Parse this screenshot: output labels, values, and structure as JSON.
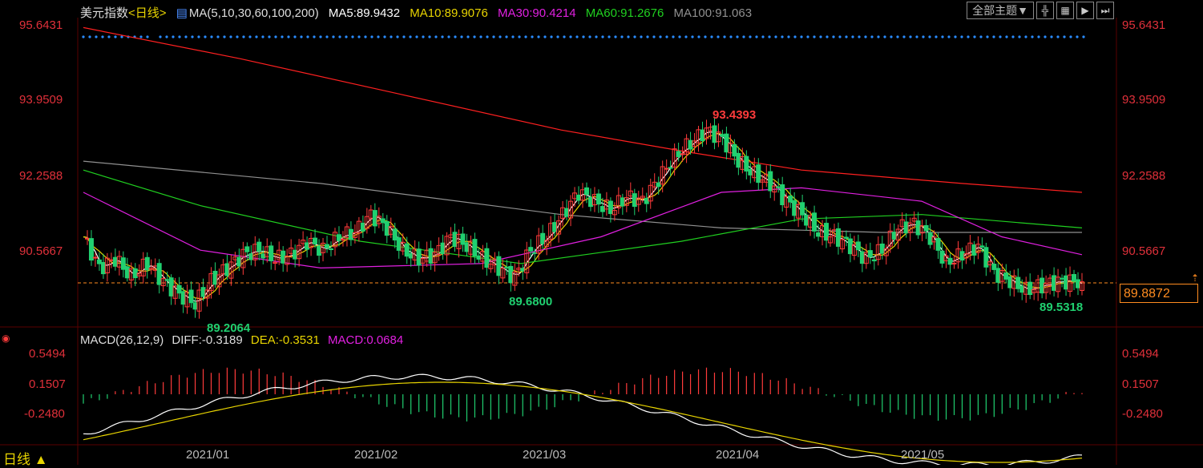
{
  "header": {
    "title": "美元指数",
    "period": "<日线>",
    "ma_label": "MA(5,10,30,60,100,200)",
    "ma5": "MA5:89.9432",
    "ma10": "MA10:89.9076",
    "ma30": "MA30:90.4214",
    "ma60": "MA60:91.2676",
    "ma100": "MA100:91.063"
  },
  "toolbar": {
    "theme_select": "全部主题▼"
  },
  "macd_header": {
    "label": "MACD(26,12,9)",
    "diff": "DIFF:-0.3189",
    "dea": "DEA:-0.3531",
    "macd": "MACD:0.0684"
  },
  "price_axis": [
    "95.6431",
    "93.9509",
    "92.2588",
    "90.5667"
  ],
  "macd_axis": [
    "0.5494",
    "0.1507",
    "-0.2480"
  ],
  "x_axis": [
    "2021/01",
    "2021/02",
    "2021/03",
    "2021/04",
    "2021/05"
  ],
  "last_price": "89.8872",
  "annotations": {
    "high": "93.4393",
    "low1": "89.2064",
    "low2": "89.6800",
    "low3": "89.5318"
  },
  "footer": {
    "period_label": "日线 ▲"
  },
  "colors": {
    "up": "#ff3b3b",
    "down": "#20d070",
    "ma5": "#ffffff",
    "ma10": "#e8d400",
    "ma30": "#e020e0",
    "ma60": "#20d020",
    "ma100": "#909090",
    "ma200": "#ff2020"
  },
  "icons": [
    "crosshair-icon",
    "grid-icon",
    "play-icon",
    "next-icon"
  ]
}
